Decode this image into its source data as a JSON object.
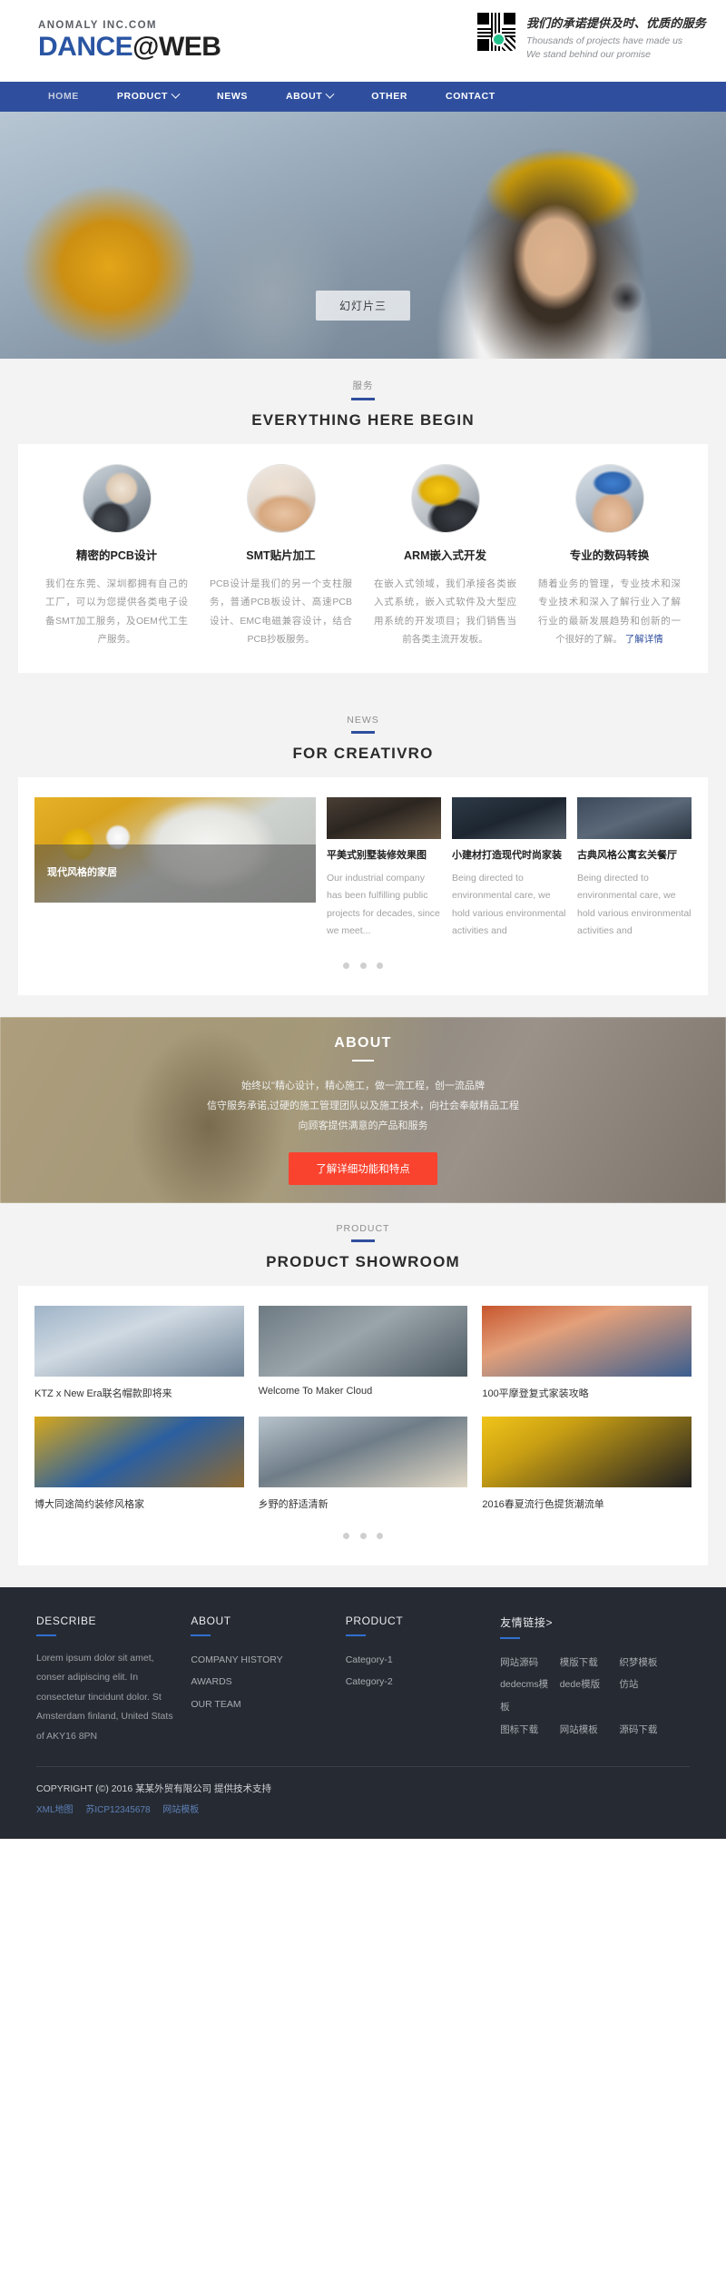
{
  "header": {
    "brand_small": "ANOMALY INC.COM",
    "brand_part1": "DANCE",
    "brand_at": "@",
    "brand_part2": "WEB",
    "qr_icon": "qr-code-icon",
    "promo_cn": "我们的承诺提供及时、优质的服务",
    "promo_en_line1": "Thousands of projects have made us",
    "promo_en_line2": "We stand behind our promise"
  },
  "nav": {
    "items": [
      {
        "label": "HOME",
        "caret": false,
        "active": true
      },
      {
        "label": "PRODUCT",
        "caret": true,
        "active": false
      },
      {
        "label": "NEWS",
        "caret": false,
        "active": false
      },
      {
        "label": "ABOUT",
        "caret": true,
        "active": false
      },
      {
        "label": "OTHER",
        "caret": false,
        "active": false
      },
      {
        "label": "CONTACT",
        "caret": false,
        "active": false
      }
    ]
  },
  "hero": {
    "slide_label": "幻灯片三"
  },
  "services": {
    "sub": "服务",
    "title": "EVERYTHING HERE BEGIN",
    "items": [
      {
        "title": "精密的PCB设计",
        "text": "我们在东莞、深圳都拥有自己的工厂，可以为您提供各类电子设备SMT加工服务，及OEM代工生产服务。"
      },
      {
        "title": "SMT贴片加工",
        "text": "PCB设计是我们的另一个支柱服务，普通PCB板设计、高速PCB设计、EMC电磁兼容设计，结合PCB抄板服务。"
      },
      {
        "title": "ARM嵌入式开发",
        "text": "在嵌入式领域，我们承接各类嵌入式系统，嵌入式软件及大型应用系统的开发项目；我们销售当前各类主流开发板。"
      },
      {
        "title": "专业的数码转换",
        "text": "随着业务的管理，专业技术和深专业技术和深入了解行业入了解行业的最新发展趋势和创新的一个很好的了解。",
        "link": "了解详情"
      }
    ]
  },
  "news": {
    "sub": "NEWS",
    "title": "FOR CREATIVRO",
    "featured": {
      "caption": "现代风格的家居"
    },
    "items": [
      {
        "title": "平美式别墅装修效果图",
        "text": "Our industrial company has been fulfilling public projects for decades, since we meet..."
      },
      {
        "title": "小建材打造现代时尚家装",
        "text": "Being directed to environmental care, we hold various environmental activities and"
      },
      {
        "title": "古典风格公寓玄关餐厅",
        "text": "Being directed to environmental care, we hold various environmental activities and"
      }
    ],
    "dots": 3
  },
  "about": {
    "title": "ABOUT",
    "lines": [
      "始终以\"精心设计，精心施工，做一流工程，创一流品牌",
      "信守服务承诺,过硬的施工管理团队以及施工技术，向社会奉献精品工程",
      "向顾客提供满意的产品和服务"
    ],
    "button": "了解详细功能和特点",
    "button_color": "#f9432f"
  },
  "products": {
    "sub": "PRODUCT",
    "title": "PRODUCT SHOWROOM",
    "items": [
      {
        "caption": "KTZ x New Era联名帽款即将来"
      },
      {
        "caption": "Welcome To Maker Cloud"
      },
      {
        "caption": "100平摩登复式家装攻略"
      },
      {
        "caption": "博大同途简约装修风格家"
      },
      {
        "caption": "乡野的舒适清新"
      },
      {
        "caption": "2016春夏流行色提货潮流单"
      }
    ],
    "dots": 3
  },
  "footer": {
    "describe": {
      "heading": "DESCRIBE",
      "text": "Lorem ipsum dolor sit amet, conser adipiscing elit. In consectetur tincidunt dolor. St Amsterdam finland, United Stats of AKY16 8PN"
    },
    "about": {
      "heading": "ABOUT",
      "links": [
        "COMPANY HISTORY",
        "AWARDS",
        "OUR TEAM"
      ]
    },
    "product": {
      "heading": "PRODUCT",
      "links": [
        "Category-1",
        "Category-2"
      ]
    },
    "friendlinks": {
      "heading": "友情链接>",
      "links": [
        "网站源码",
        "模版下载",
        "织梦模板",
        "dedecms模板",
        "dede模版",
        "仿站",
        "图标下载",
        "网站模板",
        "源码下载"
      ]
    },
    "copyright": "COPYRIGHT (©) 2016 某某外贸有限公司 提供技术支持",
    "bottom_links": [
      "XML地图",
      "苏ICP12345678",
      "网站模板"
    ],
    "accent": "#2f6fd0"
  }
}
